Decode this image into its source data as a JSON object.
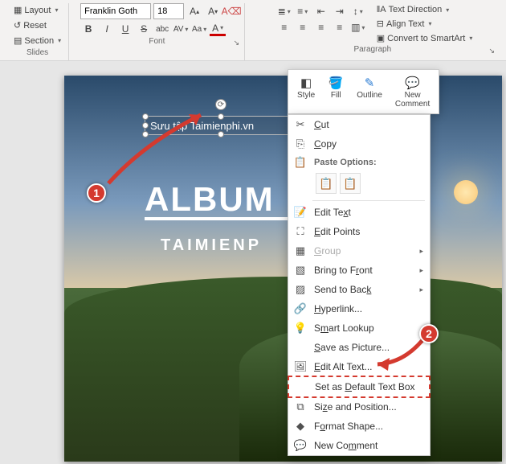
{
  "ribbon": {
    "groups": {
      "slides": {
        "layout": "Layout",
        "reset": "Reset",
        "section": "Section",
        "label": "Slides"
      },
      "font": {
        "fontName": "Franklin Goth",
        "fontSize": "18",
        "label": "Font",
        "bold": "B",
        "italic": "I",
        "underline": "U",
        "strike": "S",
        "spacing": "AV",
        "case": "Aa",
        "color": "A",
        "shadow": "abc"
      },
      "paragraph": {
        "textDirection": "Text Direction",
        "alignText": "Align Text",
        "smartArt": "Convert to SmartArt",
        "label": "Paragraph"
      }
    }
  },
  "slide": {
    "textbox": "Sưu tập Taimienphi.vn",
    "title": "ALBUM       PHO",
    "subtitle": "TAIMIENP"
  },
  "miniToolbar": {
    "style": "Style",
    "fill": "Fill",
    "outline": "Outline",
    "newComment": "New\nComment"
  },
  "contextMenu": {
    "cut": "Cut",
    "copy": "Copy",
    "pasteOptions": "Paste Options:",
    "editText": "Edit Text",
    "editPoints": "Edit Points",
    "group": "Group",
    "bringFront": "Bring to Front",
    "sendBack": "Send to Back",
    "hyperlink": "Hyperlink...",
    "smartLookup": "Smart Lookup",
    "savePicture": "Save as Picture...",
    "editAlt": "Edit Alt Text...",
    "defaultTextBox": "Set as Default Text Box",
    "sizePosition": "Size and Position...",
    "formatShape": "Format Shape...",
    "newComment": "New Comment"
  },
  "callouts": {
    "c1": "1",
    "c2": "2"
  }
}
